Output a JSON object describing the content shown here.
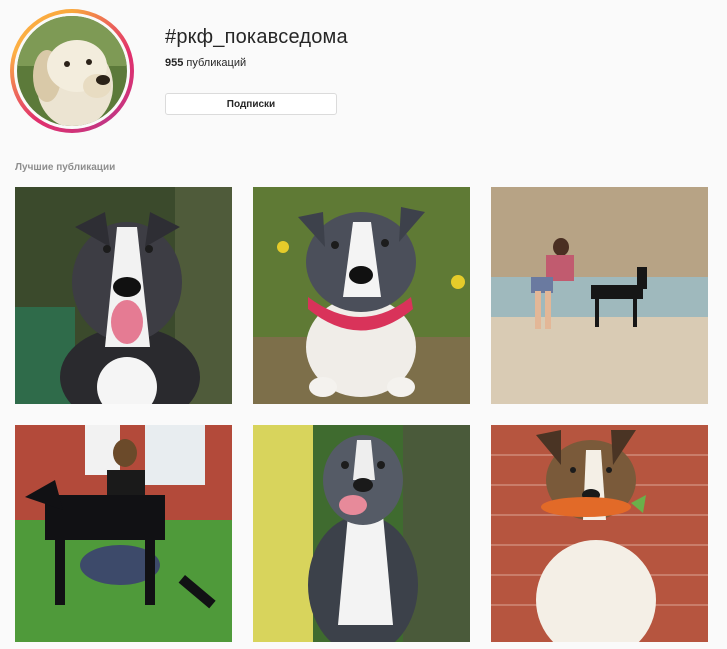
{
  "header": {
    "hashtag": "#ркф_покавседома",
    "post_count": "955",
    "post_count_label": "публикаций",
    "follow_button_label": "Подписки"
  },
  "section": {
    "title": "Лучшие публикации"
  },
  "posts": [
    {
      "subject": "amstaff-puppy-portrait"
    },
    {
      "subject": "amstaff-puppy-red-collar"
    },
    {
      "subject": "woman-with-doberman-at-beach"
    },
    {
      "subject": "woman-with-doberman-on-lawn"
    },
    {
      "subject": "blue-pitbull-sitting"
    },
    {
      "subject": "sheltie-with-toy-carrot"
    }
  ],
  "colors": {
    "accent_ring_start": "#f9a83c",
    "accent_ring_end": "#c13584",
    "muted_text": "#8e8e8e",
    "border": "#dbdbdb"
  }
}
